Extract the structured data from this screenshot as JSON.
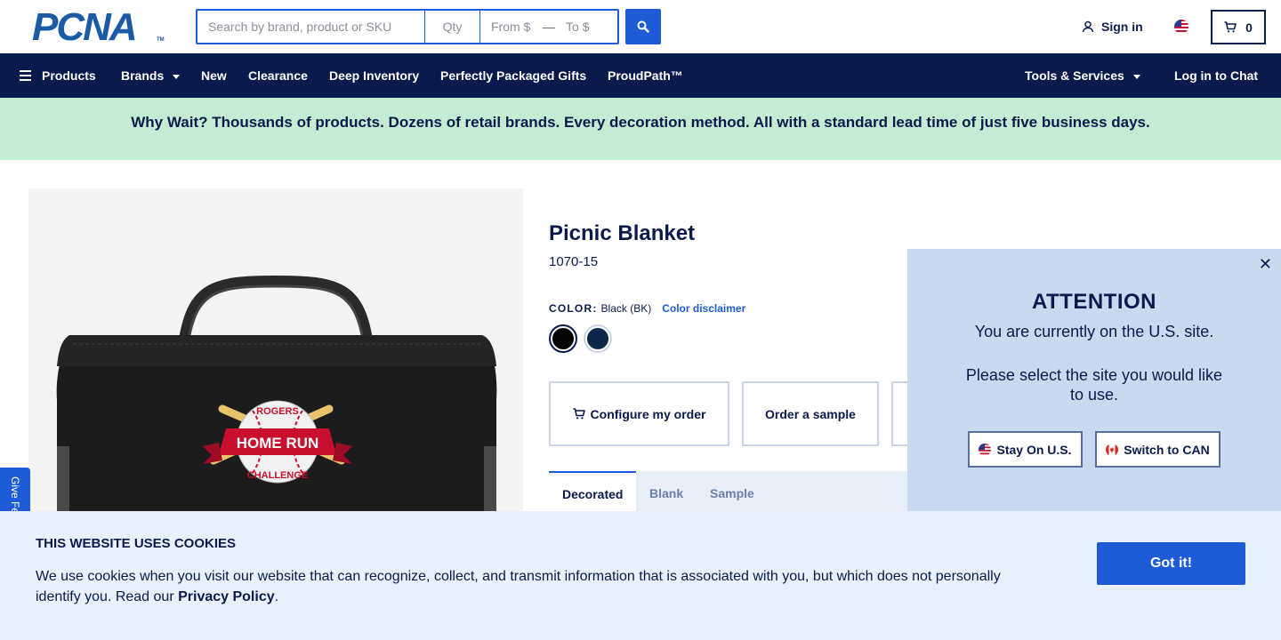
{
  "header": {
    "logo_text": "PCNA",
    "logo_tm": "TM",
    "search": {
      "main_placeholder": "Search by brand, product or SKU",
      "qty_placeholder": "Qty",
      "from_placeholder": "From $",
      "dash": "—",
      "to_placeholder": "To $"
    },
    "signin_label": "Sign in",
    "cart_count": "0"
  },
  "nav": {
    "items": [
      {
        "label": "Products"
      },
      {
        "label": "Brands"
      },
      {
        "label": "New"
      },
      {
        "label": "Clearance"
      },
      {
        "label": "Deep Inventory"
      },
      {
        "label": "Perfectly Packaged Gifts"
      },
      {
        "label": "ProudPath™"
      }
    ],
    "tools_label": "Tools & Services",
    "chat_label": "Log in to Chat"
  },
  "promo": {
    "text": "Why Wait? Thousands of products. Dozens of retail brands. Every decoration method. All with a standard lead time of just five business days."
  },
  "product": {
    "title": "Picnic Blanket",
    "sku": "1070-15",
    "color_label": "COLOR:",
    "color_value": "Black (BK)",
    "color_disclaimer": "Color disclaimer",
    "swatches": [
      {
        "name": "Black",
        "hex": "#050505"
      },
      {
        "name": "Navy",
        "hex": "#0c2748"
      }
    ],
    "logo_top": "ROGERS",
    "logo_mid": "HOME RUN",
    "logo_bottom": "CHALLENGE",
    "actions": {
      "configure": "Configure my order",
      "sample": "Order a sample"
    },
    "tabs": [
      {
        "label": "Decorated"
      },
      {
        "label": "Blank"
      },
      {
        "label": "Sample"
      }
    ]
  },
  "feedback": {
    "label": "Give Feedback"
  },
  "attention": {
    "title": "ATTENTION",
    "line1": "You are currently on the U.S. site.",
    "line2": "Please select the site you would like to use.",
    "stay_label": "Stay On U.S.",
    "switch_label": "Switch to CAN"
  },
  "cookie": {
    "title": "THIS WEBSITE USES COOKIES",
    "text": "We use cookies when you visit our website that can recognize, collect, and transmit information that is associated with you, but which does not personally identify you. Read our ",
    "link": "Privacy Policy",
    "period": ".",
    "button": "Got it!"
  },
  "colors": {
    "navy": "#0a1a4d",
    "brand_blue": "#1e5bd6",
    "promo_green": "#c3ecd3",
    "cookie_bg": "#e8f0fb",
    "attention_bg": "#c9d9ef"
  }
}
